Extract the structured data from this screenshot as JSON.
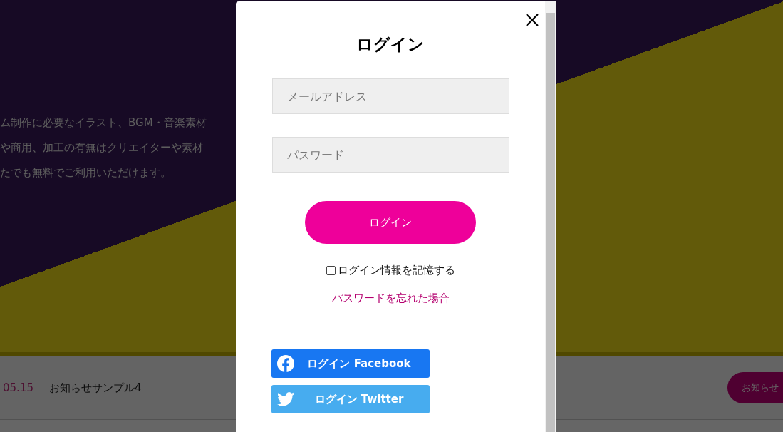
{
  "banner": {
    "lines": [
      "ム制作に必要なイラスト、BGM・音楽素材",
      "や商用、加工の有無はクリエイターや素材",
      "たでも無料でご利用いただけます。"
    ]
  },
  "news": {
    "date": "05.15",
    "title": "お知らせサンプル4",
    "button": "お知らせ"
  },
  "modal": {
    "title": "ログイン",
    "email": {
      "placeholder": "メールアドレス"
    },
    "password": {
      "placeholder": "パスワード"
    },
    "submit": "ログイン",
    "remember": {
      "label": "ログイン情報を記憶する",
      "checked": false
    },
    "forgot": "パスワードを忘れた場合",
    "social": [
      {
        "kind": "facebook",
        "label": "ログイン Facebook"
      },
      {
        "kind": "twitter",
        "label": "ログイン Twitter"
      }
    ]
  }
}
